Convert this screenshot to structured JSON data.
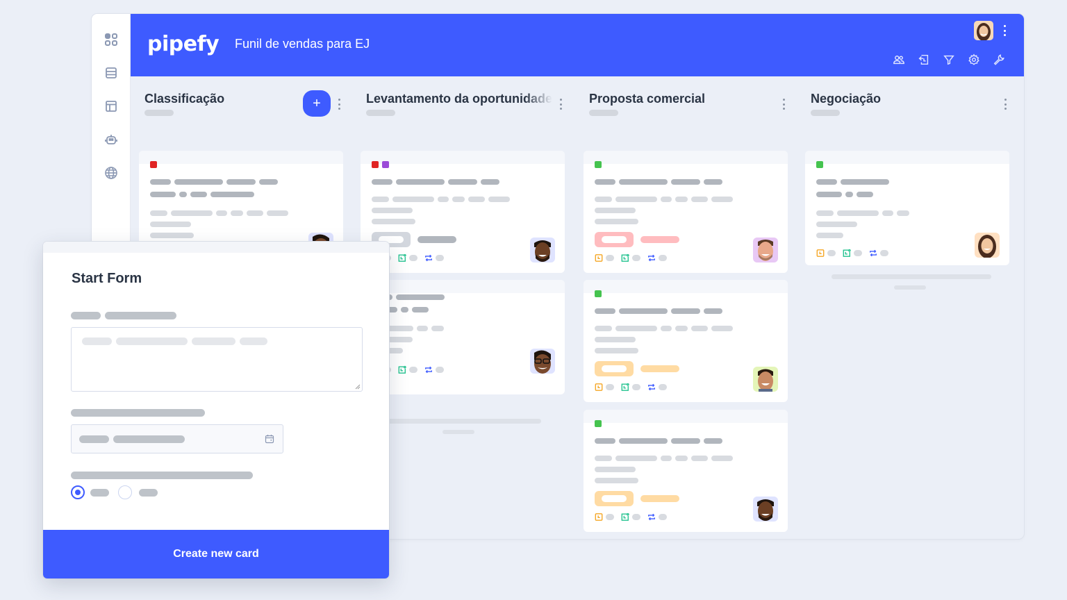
{
  "app": {
    "logo": "pipefy",
    "pipe_title": "Funil de vendas para EJ",
    "brand_color": "#3e5bff"
  },
  "sidebar": {
    "items": [
      {
        "icon": "apps-grid-icon"
      },
      {
        "icon": "database-icon"
      },
      {
        "icon": "interface-layout-icon"
      },
      {
        "icon": "automation-robot-icon"
      },
      {
        "icon": "globe-icon"
      }
    ]
  },
  "topbar": {
    "user_avatar": "user-avatar",
    "tools": [
      {
        "icon": "members-icon"
      },
      {
        "icon": "import-icon"
      },
      {
        "icon": "filter-icon"
      },
      {
        "icon": "settings-gear-icon"
      },
      {
        "icon": "wrench-icon"
      }
    ]
  },
  "phases": [
    {
      "name": "Classificação",
      "has_add_button": true,
      "add_label": "+",
      "cards": [
        {
          "labels": [
            "#e02424"
          ],
          "tag": null,
          "avatar_bg": "#dfe3ff"
        }
      ]
    },
    {
      "name": "Levantamento da oportunidade",
      "cards": [
        {
          "labels": [
            "#e02424",
            "#9b4bd8"
          ],
          "tag": "gray",
          "avatar_bg": "#dfe3ff"
        },
        {
          "labels": [],
          "tag": null,
          "avatar_bg": "#dfe3ff"
        }
      ]
    },
    {
      "name": "Proposta comercial",
      "cards": [
        {
          "labels": [
            "#45c34f"
          ],
          "tag": "pink",
          "avatar_bg": "#e8c8f5"
        },
        {
          "labels": [
            "#45c34f"
          ],
          "tag": "orange",
          "avatar_bg": "#e4f5b8"
        },
        {
          "labels": [
            "#45c34f"
          ],
          "tag": "orange",
          "avatar_bg": "#dfe3ff"
        }
      ]
    },
    {
      "name": "Negociação",
      "cards": [
        {
          "labels": [
            "#45c34f"
          ],
          "tag": null,
          "avatar_bg": "#ffe0c2"
        }
      ]
    }
  ],
  "start_form": {
    "title": "Start Form",
    "submit_label": "Create new card",
    "radio_selected_index": 0
  }
}
